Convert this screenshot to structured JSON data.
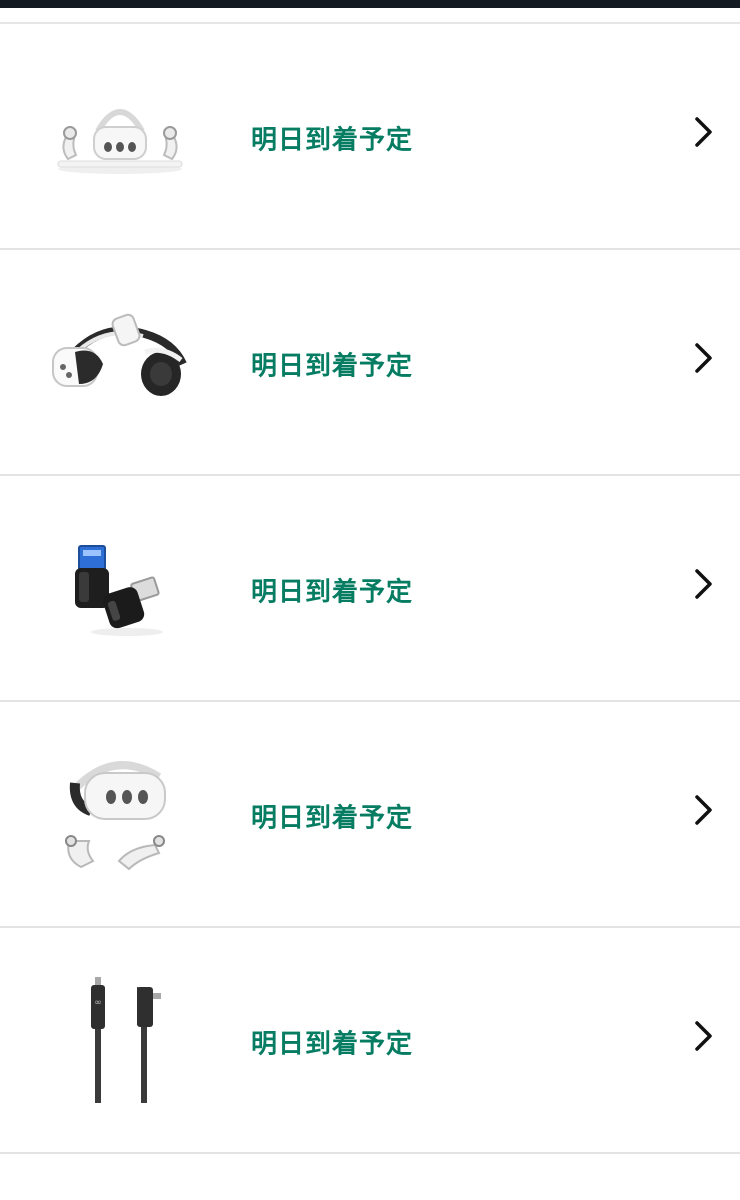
{
  "items": [
    {
      "product": "headset-with-controllers-icon",
      "delivery_status": "明日到着予定"
    },
    {
      "product": "elite-strap-headset-icon",
      "delivery_status": "明日到着予定"
    },
    {
      "product": "usb-adapter-icon",
      "delivery_status": "明日到着予定"
    },
    {
      "product": "headset-controllers-set-icon",
      "delivery_status": "明日到着予定"
    },
    {
      "product": "usb-c-link-cable-icon",
      "delivery_status": "明日到着予定"
    }
  ],
  "colors": {
    "status": "#067d62",
    "divider": "#e3e3e3",
    "topbar": "#131a22"
  }
}
